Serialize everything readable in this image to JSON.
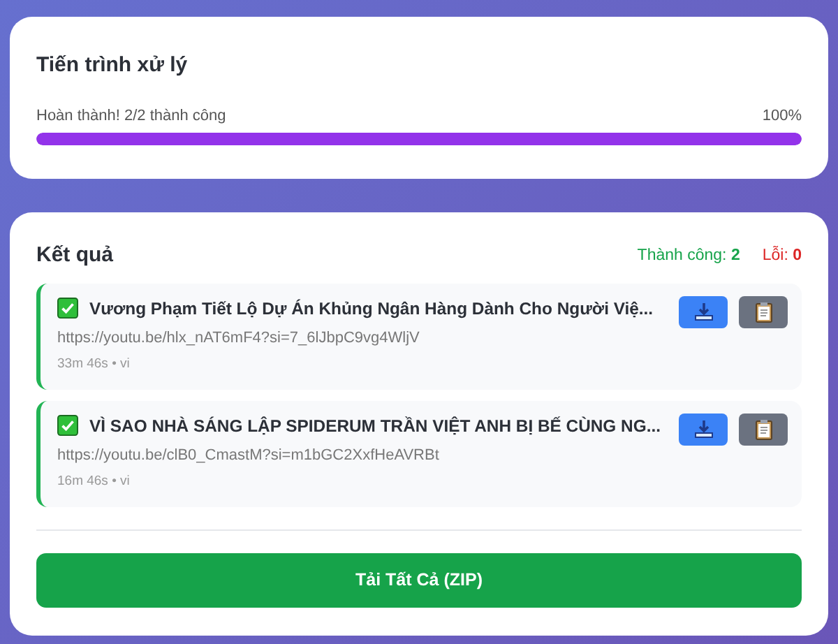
{
  "progress": {
    "title": "Tiến trình xử lý",
    "status": "Hoàn thành! 2/2 thành công",
    "percent": "100%",
    "level": 1
  },
  "results": {
    "title": "Kết quả",
    "success_summary": "Thành công: **2**",
    "error_summary": "Lỗi: **0**",
    "items": [
      {
        "succeeded": true,
        "title": "Vương Phạm Tiết Lộ Dự Án Khủng Ngân Hàng Dành Cho Người Việ...",
        "url": "https://youtu.be/hlx_nAT6mF4?si=7_6lJbpC9vg4WljV",
        "meta": "33m 46s • vi"
      },
      {
        "succeeded": true,
        "title": "VÌ SAO NHÀ SÁNG LẬP SPIDERUM TRẦN VIỆT ANH BỊ BẾ CÙNG NG...",
        "url": "https://youtu.be/clB0_CmastM?si=m1bGC2XxfHeAVRBt",
        "meta": "16m 46s • vi"
      }
    ],
    "download_all": "Tải Tất Cả (ZIP)"
  }
}
